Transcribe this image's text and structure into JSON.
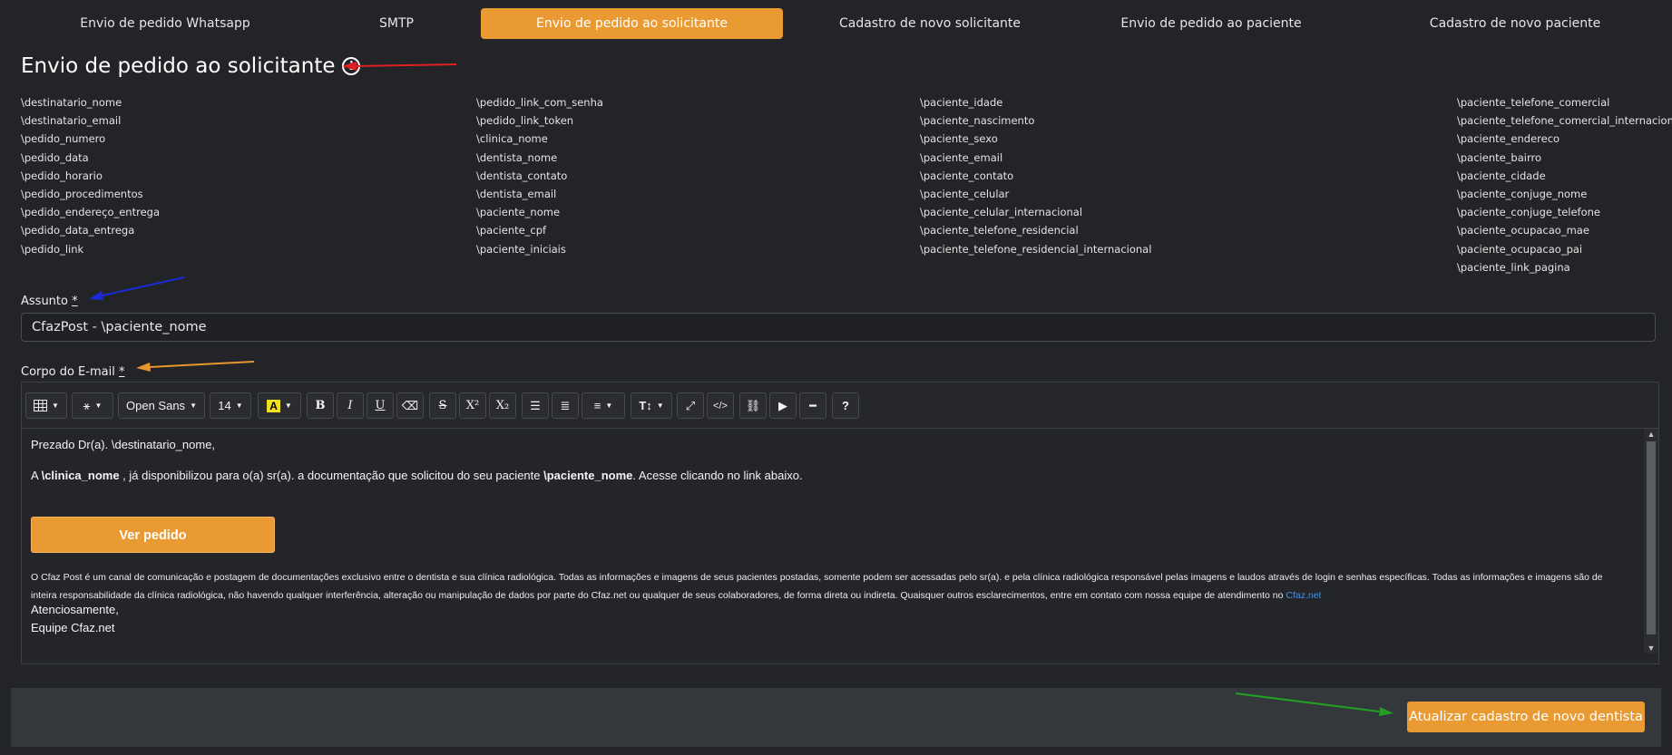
{
  "tabs": [
    {
      "label": "Envio de pedido Whatsapp"
    },
    {
      "label": "SMTP"
    },
    {
      "label": "Envio de pedido ao solicitante",
      "active": true
    },
    {
      "label": "Cadastro de novo solicitante"
    },
    {
      "label": "Envio de pedido ao paciente"
    },
    {
      "label": "Cadastro de novo paciente"
    }
  ],
  "page_title": "Envio de pedido ao solicitante",
  "variables": {
    "col1": [
      "\\destinatario_nome",
      "\\destinatario_email",
      "\\pedido_numero",
      "\\pedido_data",
      "\\pedido_horario",
      "\\pedido_procedimentos",
      "\\pedido_endereço_entrega",
      "\\pedido_data_entrega",
      "\\pedido_link"
    ],
    "col2": [
      "\\pedido_link_com_senha",
      "\\pedido_link_token",
      "\\clinica_nome",
      "\\dentista_nome",
      "\\dentista_contato",
      "\\dentista_email",
      "\\paciente_nome",
      "\\paciente_cpf",
      "\\paciente_iniciais"
    ],
    "col3": [
      "\\paciente_idade",
      "\\paciente_nascimento",
      "\\paciente_sexo",
      "\\paciente_email",
      "\\paciente_contato",
      "\\paciente_celular",
      "\\paciente_celular_internacional",
      "\\paciente_telefone_residencial",
      "\\paciente_telefone_residencial_internacional"
    ],
    "col4": [
      "\\paciente_telefone_comercial",
      "\\paciente_telefone_comercial_internacional",
      "\\paciente_endereco",
      "\\paciente_bairro",
      "\\paciente_cidade",
      "\\paciente_conjuge_nome",
      "\\paciente_conjuge_telefone",
      "\\paciente_ocupacao_mae",
      "\\paciente_ocupacao_pai",
      "\\paciente_link_pagina"
    ]
  },
  "subject": {
    "label": "Assunto",
    "required_mark": "*",
    "value": "CfazPost - \\paciente_nome"
  },
  "body_field": {
    "label": "Corpo do E-mail",
    "required_mark": "*"
  },
  "toolbar": {
    "font_family": "Open Sans",
    "font_size": "14",
    "bold": "B",
    "italic": "I",
    "underline": "U",
    "strike": "S",
    "superscript": "X²",
    "subscript": "X₂",
    "text_size": "T↕",
    "help": "?"
  },
  "editor_content": {
    "greeting": "Prezado Dr(a). \\destinatario_nome,",
    "line_a": "A ",
    "clinic_var": "\\clinica_nome",
    "line_b": " , já disponibilizou para o(a) sr(a). a documentação que solicitou do seu paciente ",
    "patient_var": "\\paciente_nome",
    "line_c": ". Acesse clicando no link abaixo.",
    "button": "Ver pedido",
    "legal_text": "O Cfaz Post é um canal de comunicação e postagem de documentações exclusivo entre o dentista e sua clínica radiológica. Todas as informações e imagens de seus pacientes postadas, somente podem ser acessadas pelo sr(a). e pela clínica radiológica responsável pelas imagens e laudos através de login e senhas específicas. Todas as informações e imagens são de inteira responsabilidade da clínica radiológica, não havendo qualquer interferência, alteração ou manipulação de dados por parte do Cfaz.net ou qualquer de seus colaboradores, de forma direta ou indireta. Quaisquer outros esclarecimentos, entre em contato com nossa equipe de atendimento no ",
    "legal_link": "Cfaz.net",
    "sign_1": "Atenciosamente,",
    "sign_2": "Equipe Cfaz.net"
  },
  "save_button": "Atualizar cadastro de novo dentista",
  "colors": {
    "accent": "#ea9a33",
    "background": "#222427",
    "link": "#4a90e2"
  }
}
